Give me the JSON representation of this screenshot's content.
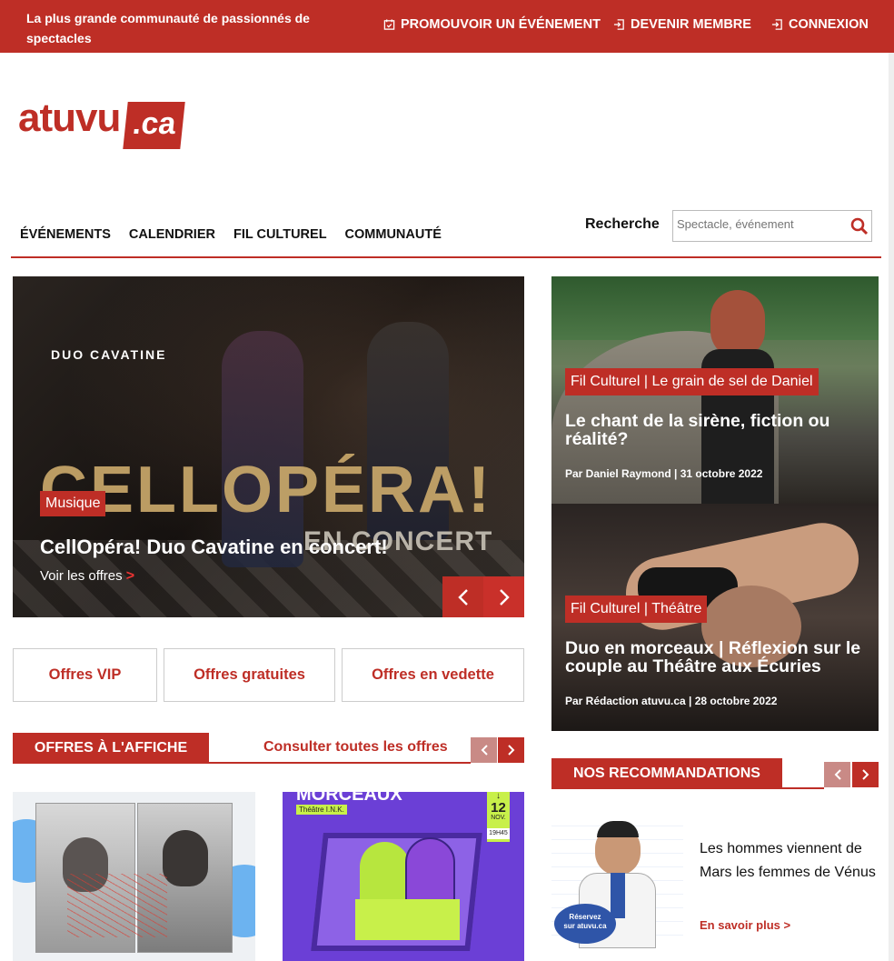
{
  "topbar": {
    "tagline": "La plus grande communauté de passionnés de spectacles",
    "links": [
      "PROMOUVOIR UN ÉVÉNEMENT",
      "DEVENIR MEMBRE",
      "CONNEXION"
    ]
  },
  "logo": {
    "word": "atuvu",
    "tld": ".ca"
  },
  "nav": {
    "items": [
      "ÉVÉNEMENTS",
      "CALENDRIER",
      "FIL CULTUREL",
      "COMMUNAUTÉ"
    ]
  },
  "search": {
    "label": "Recherche",
    "placeholder": "Spectacle, événement"
  },
  "hero": {
    "brand": "DUO CAVATINE",
    "poster_big": "CELLOPÉRA!",
    "poster_sub": "EN CONCERT",
    "tag": "Musique",
    "title": "CellOpéra! Duo Cavatine en concert!",
    "link": "Voir les offres",
    "link_arrow": ">"
  },
  "offer_buttons": [
    "Offres VIP",
    "Offres gratuites",
    "Offres en vedette"
  ],
  "affiche": {
    "label": "OFFRES À L'AFFICHE",
    "all_link": "Consulter toutes les offres"
  },
  "thumb2": {
    "title": "MORCEAUX",
    "venue": "Théâtre I.N.K.",
    "date_day": "12",
    "date_month": "NOV.",
    "time": "19H45"
  },
  "cards": [
    {
      "tag": "Fil Culturel | Le grain de sel de Daniel",
      "title": "Le chant de la sirène, fiction ou réalité?",
      "meta": "Par Daniel Raymond | 31 octobre 2022"
    },
    {
      "tag": "Fil Culturel | Théâtre",
      "title": "Duo en morceaux | Réflexion sur le couple au Théâtre aux Écuries",
      "meta": "Par Rédaction atuvu.ca | 28 octobre 2022"
    }
  ],
  "recommandations": {
    "label": "NOS RECOMMANDATIONS",
    "item_title": "Les hommes viennent de Mars les femmes de Vénus",
    "item_link": "En savoir plus >",
    "badge_line1": "Réservez",
    "badge_line2": "sur atuvu.ca"
  },
  "colors": {
    "brand": "#be2e26"
  }
}
